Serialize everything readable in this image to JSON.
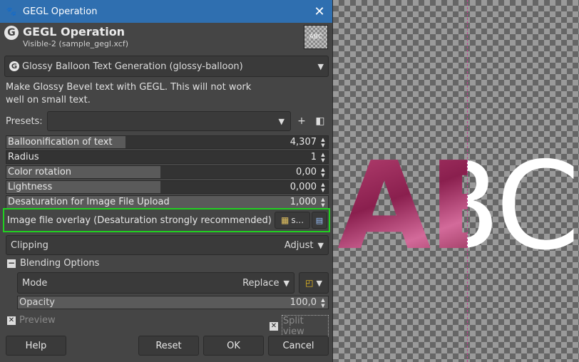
{
  "window": {
    "title": "GEGL Operation",
    "close_label": "✕"
  },
  "header": {
    "title": "GEGL Operation",
    "subtitle": "Visible-2 (sample_gegl.xcf)",
    "thumb_text": "ABC"
  },
  "operation": {
    "selected": "Glossy Balloon Text Generation (glossy-balloon)"
  },
  "description": "Make Glossy Bevel text with GEGL. This will not work well on small text.",
  "presets": {
    "label": "Presets:",
    "value": ""
  },
  "sliders": [
    {
      "label": "Balloonification of text",
      "value": "4,307",
      "fill": 0.37
    },
    {
      "label": "Radius",
      "value": "1",
      "fill": 0.0
    },
    {
      "label": "Color rotation",
      "value": "0,00",
      "fill": 0.48
    },
    {
      "label": "Lightness",
      "value": "0,000",
      "fill": 0.48
    },
    {
      "label": "Desaturation for Image File Upload",
      "value": "1,000",
      "fill": 1.0
    }
  ],
  "overlay": {
    "label": "Image file overlay (Desaturation  strongly recommended)",
    "file_button": "s..."
  },
  "clipping": {
    "label": "Clipping",
    "value": "Adjust"
  },
  "blending": {
    "label": "Blending Options",
    "mode_label": "Mode",
    "mode_value": "Replace",
    "opacity_label": "Opacity",
    "opacity_value": "100,0"
  },
  "checks": {
    "preview": "Preview",
    "split_view": "Split view"
  },
  "buttons": {
    "help": "Help",
    "reset": "Reset",
    "ok": "OK",
    "cancel": "Cancel"
  },
  "canvas": {
    "text": "ABC"
  },
  "colors": {
    "titlebar": "#2f6fb0",
    "highlight": "#20d020",
    "guide": "#c04090"
  }
}
